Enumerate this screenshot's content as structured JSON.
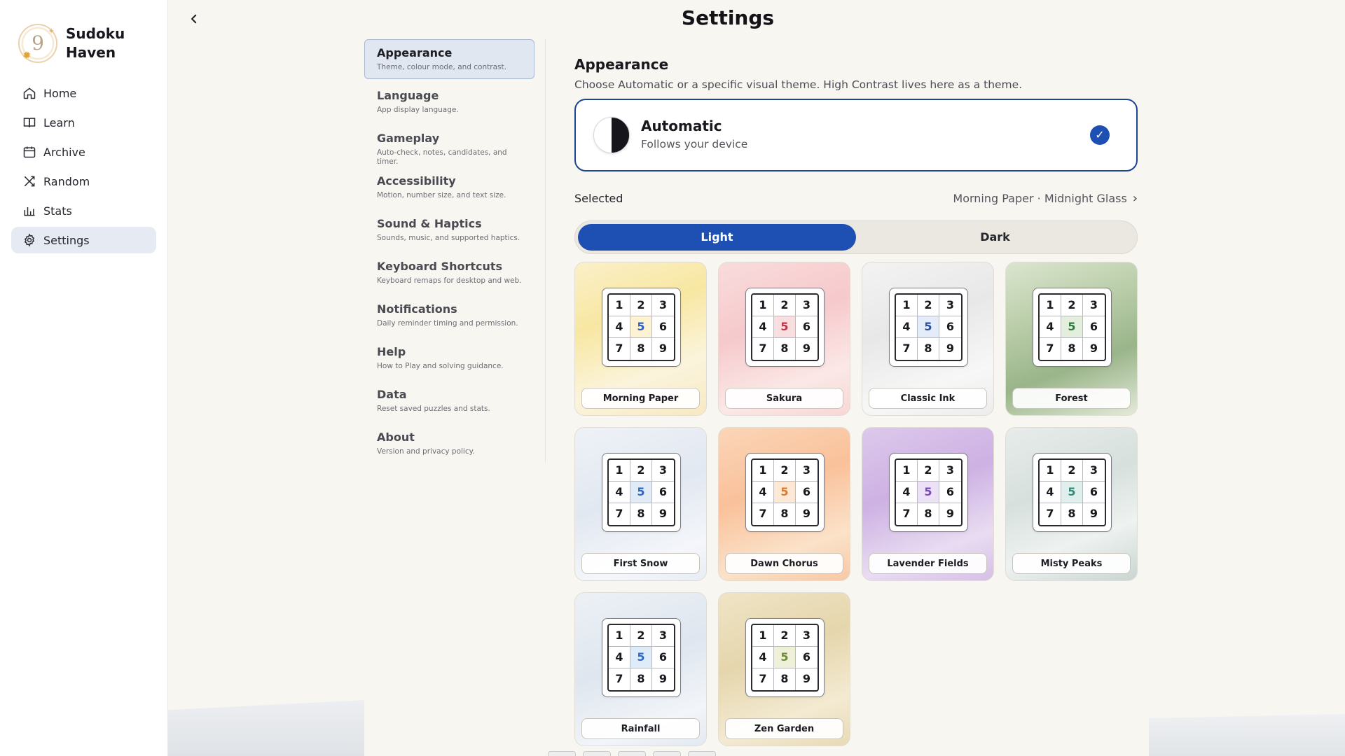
{
  "brand": {
    "name": "Sudoku Haven",
    "logo_glyph": "9",
    "logo_icon": "sun-icon"
  },
  "nav": [
    {
      "label": "Home",
      "icon": "home-icon",
      "active": false
    },
    {
      "label": "Learn",
      "icon": "book-icon",
      "active": false
    },
    {
      "label": "Archive",
      "icon": "calendar-icon",
      "active": false
    },
    {
      "label": "Random",
      "icon": "shuffle-icon",
      "active": false
    },
    {
      "label": "Stats",
      "icon": "bar-chart-icon",
      "active": false
    },
    {
      "label": "Settings",
      "icon": "gear-icon",
      "active": true
    }
  ],
  "header": {
    "title": "Settings",
    "back_icon": "chevron-left-icon"
  },
  "subnav": [
    {
      "label": "Appearance",
      "desc": "Theme, colour mode, and contrast.",
      "active": true
    },
    {
      "label": "Language",
      "desc": "App display language."
    },
    {
      "label": "Gameplay",
      "desc": "Auto-check, notes, candidates, and timer."
    },
    {
      "label": "Accessibility",
      "desc": "Motion, number size, and text size."
    },
    {
      "label": "Sound & Haptics",
      "desc": "Sounds, music, and supported haptics."
    },
    {
      "label": "Keyboard Shortcuts",
      "desc": "Keyboard remaps for desktop and web."
    },
    {
      "label": "Notifications",
      "desc": "Daily reminder timing and permission."
    },
    {
      "label": "Help",
      "desc": "How to Play and solving guidance."
    },
    {
      "label": "Data",
      "desc": "Reset saved puzzles and stats."
    },
    {
      "label": "About",
      "desc": "Version and privacy policy."
    }
  ],
  "appearance": {
    "title": "Appearance",
    "desc": "Choose Automatic or a specific visual theme. High Contrast lives here as a theme.",
    "auto": {
      "title": "Automatic",
      "subtitle": "Follows your device",
      "checked": true,
      "check_icon": "checkmark-icon"
    },
    "selected_label": "Selected",
    "selected_value": "Morning Paper · Midnight Glass",
    "selected_chevron": "›",
    "modes": [
      {
        "label": "Light",
        "active": true
      },
      {
        "label": "Dark",
        "active": false
      }
    ]
  },
  "grid_numbers": [
    "1",
    "2",
    "3",
    "4",
    "5",
    "6",
    "7",
    "8",
    "9"
  ],
  "themes": [
    {
      "name": "Morning Paper",
      "bg": "linear-gradient(160deg,#fbf0c9 0%,#f8e7a2 35%,#fbf4dc 70%,#f7e9c2 100%)",
      "accent": "#2f5fc4",
      "center_bg": "#fdf3d2"
    },
    {
      "name": "Sakura",
      "bg": "linear-gradient(160deg,#f9dcdc 0%,#f6c9cc 40%,#fbe8e6 75%,#f7d7d5 100%)",
      "accent": "#c2334a",
      "center_bg": "#f9dedf"
    },
    {
      "name": "Classic Ink",
      "bg": "linear-gradient(160deg,#f3f3f3 0%,#e8e8e8 40%,#f7f7f7 75%,#ededed 100%)",
      "accent": "#2b4ea2",
      "center_bg": "#e3ecf8"
    },
    {
      "name": "Forest",
      "bg": "linear-gradient(160deg,#dbe5cf 0%,#b9cda8 35%,#9ab58a 65%,#e4ead9 100%)",
      "accent": "#2f7a3c",
      "center_bg": "#e3efdc"
    },
    {
      "name": "First Snow",
      "bg": "linear-gradient(160deg,#eef2f7 0%,#e2e8f1 45%,#f4f6fa 80%,#e8edf4 100%)",
      "accent": "#2f63c2",
      "center_bg": "#e1ebf8"
    },
    {
      "name": "Dawn Chorus",
      "bg": "linear-gradient(160deg,#fbd6b8 0%,#f9c19a 40%,#fbe2c9 75%,#f7c8a4 100%)",
      "accent": "#e0782a",
      "center_bg": "#fde8d6"
    },
    {
      "name": "Lavender Fields",
      "bg": "linear-gradient(160deg,#ddc9ec 0%,#cdb1e3 40%,#e9dcf2 75%,#d6bfe6 100%)",
      "accent": "#7a4bb8",
      "center_bg": "#ece1f6"
    },
    {
      "name": "Misty Peaks",
      "bg": "linear-gradient(160deg,#e7ecea 0%,#d7e0dd 40%,#eef2f0 70%,#c9d5d1 100%)",
      "accent": "#2f8a7a",
      "center_bg": "#dff0ec"
    },
    {
      "name": "Rainfall",
      "bg": "linear-gradient(160deg,#edf1f6 0%,#dfe6ef 45%,#f2f5f9 80%,#e3e9f1 100%)",
      "accent": "#2f6ac8",
      "center_bg": "#deebf9"
    },
    {
      "name": "Zen Garden",
      "bg": "linear-gradient(160deg,#efe4c6 0%,#e5d6ac 40%,#f3ead2 75%,#e8dab6 100%)",
      "accent": "#6f8a3a",
      "center_bg": "#eef0d8"
    }
  ]
}
